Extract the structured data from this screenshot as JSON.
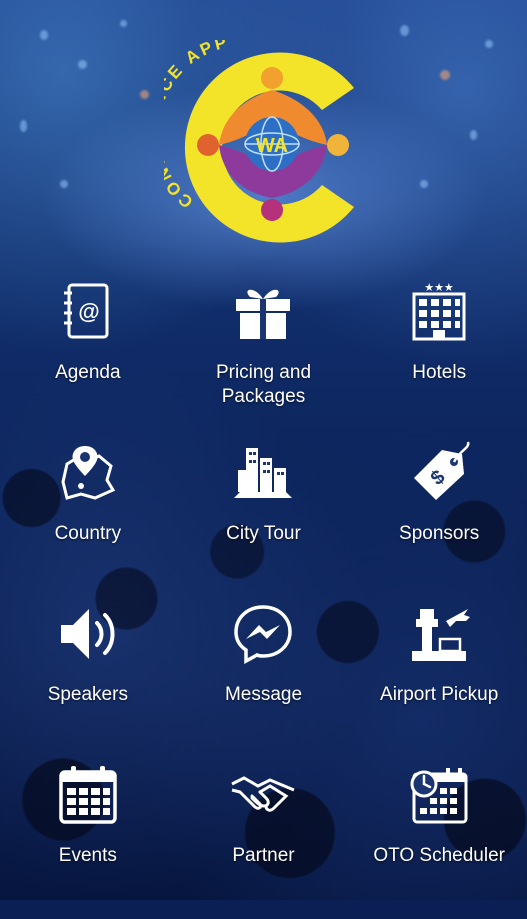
{
  "app": {
    "logo_text": "CONFERENCE APP",
    "logo_initials": "WA",
    "logo_color": "#f3e329"
  },
  "menu": [
    {
      "label": "Agenda",
      "icon": "address-book-icon"
    },
    {
      "label": "Pricing and Packages",
      "icon": "gift-box-icon"
    },
    {
      "label": "Hotels",
      "icon": "hotel-icon"
    },
    {
      "label": "Country",
      "icon": "map-location-icon"
    },
    {
      "label": "City Tour",
      "icon": "city-buildings-icon"
    },
    {
      "label": "Sponsors",
      "icon": "price-tag-icon"
    },
    {
      "label": "Speakers",
      "icon": "speaker-volume-icon"
    },
    {
      "label": "Message",
      "icon": "messenger-icon"
    },
    {
      "label": "Airport Pickup",
      "icon": "airport-tower-icon"
    },
    {
      "label": "Events",
      "icon": "calendar-icon"
    },
    {
      "label": "Partner",
      "icon": "handshake-icon"
    },
    {
      "label": "OTO Scheduler",
      "icon": "scheduler-clock-icon"
    }
  ]
}
